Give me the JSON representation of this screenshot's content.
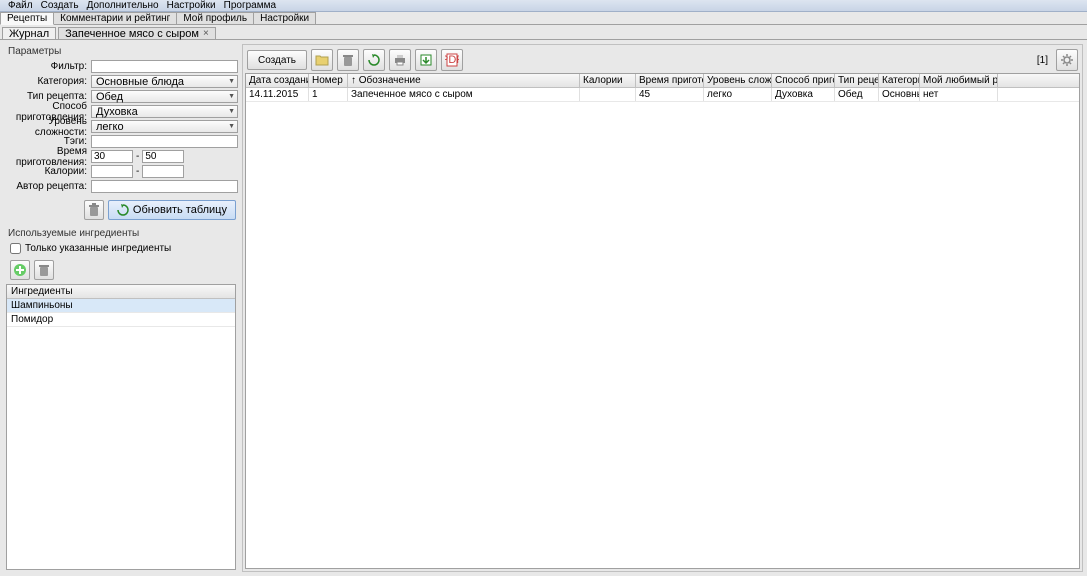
{
  "menubar": [
    "Файл",
    "Создать",
    "Дополнительно",
    "Настройки",
    "Программа"
  ],
  "mainTabs": [
    {
      "label": "Рецепты",
      "active": true
    },
    {
      "label": "Комментарии и рейтинг",
      "active": false
    },
    {
      "label": "Мой профиль",
      "active": false
    },
    {
      "label": "Настройки",
      "active": false
    }
  ],
  "subTabs": [
    {
      "label": "Журнал",
      "closable": false,
      "active": true
    },
    {
      "label": "Запеченное мясо с сыром",
      "closable": true,
      "active": false
    }
  ],
  "params": {
    "sectionTitle": "Параметры",
    "labels": {
      "filter": "Фильтр:",
      "category": "Категория:",
      "recipeType": "Тип рецепта:",
      "cookingMethod": "Способ приготовления:",
      "difficulty": "Уровень сложности:",
      "tags": "Тэги:",
      "cookingTime": "Время приготовления:",
      "calories": "Калории:",
      "author": "Автор рецепта:"
    },
    "values": {
      "filter": "",
      "category": "Основные блюда",
      "recipeType": "Обед",
      "cookingMethod": "Духовка",
      "difficulty": "легко",
      "tags": "",
      "timeFrom": "30",
      "timeTo": "50",
      "calFrom": "",
      "calTo": "",
      "author": ""
    },
    "refreshLabel": "Обновить таблицу"
  },
  "ingredients": {
    "sectionTitle": "Используемые ингредиенты",
    "onlySpecifiedLabel": "Только указанные ингредиенты",
    "headerLabel": "Ингредиенты",
    "items": [
      "Шампиньоны",
      "Помидор"
    ]
  },
  "toolbar": {
    "createLabel": "Создать",
    "pageInfo": "[1]"
  },
  "grid": {
    "headers": [
      "Дата создания",
      "Номер",
      "↑ Обозначение",
      "Калории",
      "Время приготовле...",
      "Уровень сложности",
      "Способ приготовл...",
      "Тип рецепта",
      "Категория",
      "Мой любимый рецепт"
    ],
    "rows": [
      {
        "date": "14.11.2015",
        "num": "1",
        "name": "Запеченное мясо с сыром",
        "cal": "",
        "time": "45",
        "diff": "легко",
        "method": "Духовка",
        "type": "Обед",
        "cat": "Основны...",
        "fav": "нет"
      }
    ]
  }
}
